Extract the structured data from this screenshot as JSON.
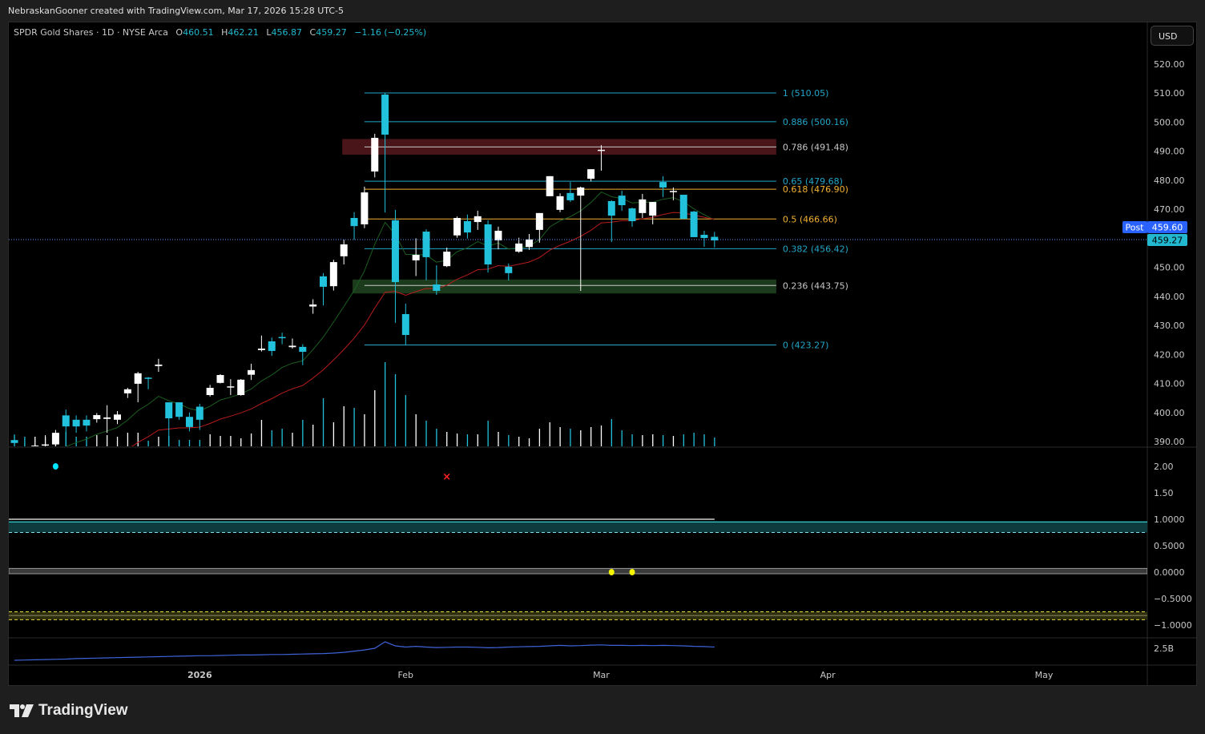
{
  "credit": "NebraskanGooner created with TradingView.com, Mar 17, 2026 15:28 UTC-5",
  "legend": {
    "symbol": "SPDR Gold Shares · 1D · NYSE Arca",
    "o_label": "O",
    "o": "460.51",
    "h_label": "H",
    "h": "462.21",
    "l_label": "L",
    "l": "456.87",
    "c_label": "C",
    "c": "459.27",
    "change": "−1.16 (−0.25%)"
  },
  "currency_button": "USD",
  "price_labels": {
    "post_tag": "Post",
    "post_price": "459.60",
    "last_price": "459.27"
  },
  "logo": "TradingView",
  "colors": {
    "up": "#ffffff",
    "down": "#22c1dc",
    "fib_cyan": "#22a6c8",
    "fib_orange": "#f2b134",
    "fib_grey": "#c8c8c8",
    "ema_fast": "#1b5e20",
    "ema_slow": "#b71c1c",
    "post": "#2962ff"
  },
  "chart_data": {
    "type": "candlestick",
    "title": "SPDR Gold Shares · 1D · NYSE Arca",
    "ylim": [
      390,
      520
    ],
    "y_ticks": [
      "520.00",
      "510.00",
      "500.00",
      "490.00",
      "480.00",
      "470.00",
      "460.00",
      "450.00",
      "440.00",
      "430.00",
      "420.00",
      "410.00",
      "400.00",
      "390.00"
    ],
    "x_ticks": [
      {
        "label": "2026",
        "bar": 18,
        "bold": true
      },
      {
        "label": "Feb",
        "bar": 38
      },
      {
        "label": "Mar",
        "bar": 57
      },
      {
        "label": "Apr",
        "bar": 79
      },
      {
        "label": "May",
        "bar": 100
      }
    ],
    "ohlc": [
      [
        390.5,
        392.5,
        388,
        389.5
      ],
      [
        388,
        389.5,
        386,
        387.5
      ],
      [
        387.5,
        389,
        386,
        388.6
      ],
      [
        388.6,
        392.2,
        388,
        389
      ],
      [
        389,
        394,
        388.5,
        393
      ],
      [
        399,
        401,
        388,
        395.2
      ],
      [
        397.5,
        399,
        393,
        395.2
      ],
      [
        397.5,
        399,
        393.5,
        395.5
      ],
      [
        397.7,
        399.8,
        396.5,
        399.1
      ],
      [
        397.8,
        402.5,
        393,
        398.3
      ],
      [
        397.5,
        400.5,
        396,
        399.3
      ],
      [
        406.6,
        408.5,
        405,
        408
      ],
      [
        409.9,
        414,
        403.5,
        413.5
      ],
      [
        412,
        412.2,
        408,
        411.6
      ],
      [
        416,
        418.5,
        414,
        416.5
      ],
      [
        403.5,
        403.5,
        388,
        398
      ],
      [
        403.5,
        403.5,
        397.5,
        398.5
      ],
      [
        398.5,
        400,
        393.5,
        395
      ],
      [
        402,
        403,
        394,
        397.5
      ],
      [
        406,
        409.5,
        405.5,
        408.5
      ],
      [
        410.2,
        413.2,
        410,
        412.9
      ],
      [
        408.6,
        411.5,
        406,
        409
      ],
      [
        406,
        411.5,
        405.8,
        411.3
      ],
      [
        413,
        416.8,
        411.2,
        414.6
      ],
      [
        421.5,
        426.5,
        421,
        422
      ],
      [
        424.5,
        425.8,
        419.5,
        421.2
      ],
      [
        426,
        427.5,
        423.5,
        425.8
      ],
      [
        422.5,
        425.5,
        422,
        423
      ],
      [
        422.6,
        423.5,
        416.3,
        420.9
      ],
      [
        436.5,
        439,
        434,
        437.2
      ],
      [
        446.9,
        448,
        436.9,
        443.3
      ],
      [
        443.5,
        452.6,
        442,
        451.8
      ],
      [
        453.8,
        459.5,
        451,
        457.9
      ],
      [
        467,
        469,
        459.5,
        464.2
      ],
      [
        464.8,
        477.8,
        463.5,
        475.8
      ],
      [
        483,
        496,
        481,
        494.6
      ],
      [
        509.5,
        510.05,
        468.9,
        495.7
      ],
      [
        466.2,
        469.8,
        430.9,
        444.9
      ],
      [
        433.9,
        437.5,
        423.27,
        426.7
      ],
      [
        452.4,
        460,
        447,
        454.3
      ],
      [
        462.3,
        463.1,
        445.5,
        453.5
      ],
      [
        444.1,
        450.7,
        440.5,
        441.9
      ],
      [
        450.4,
        456.8,
        450.1,
        455.4
      ],
      [
        461,
        467.5,
        460.2,
        467
      ],
      [
        465.9,
        468.2,
        459.9,
        462
      ],
      [
        465.6,
        469.5,
        462.9,
        467.6
      ],
      [
        464.8,
        466.2,
        448.2,
        451
      ],
      [
        459.3,
        464,
        456.2,
        462.6
      ],
      [
        450.2,
        451.3,
        445.5,
        448
      ],
      [
        455.4,
        460.2,
        455,
        458.2
      ],
      [
        457,
        461.5,
        456,
        459.6
      ],
      [
        462.9,
        468.7,
        458.5,
        468.7
      ],
      [
        474.5,
        481.4,
        474.5,
        481.4
      ],
      [
        469.8,
        475.5,
        469,
        474.5
      ],
      [
        475.6,
        479.4,
        472.5,
        473.1
      ],
      [
        474.7,
        477.8,
        441.9,
        477.5
      ],
      [
        480.5,
        483.8,
        479.6,
        483.8
      ],
      [
        490.2,
        492.1,
        483.3,
        490.5
      ],
      [
        472.8,
        473.1,
        458.7,
        467.8
      ],
      [
        474.7,
        476.4,
        469.5,
        471.4
      ],
      [
        470.3,
        470.6,
        464,
        465.9
      ],
      [
        468.7,
        475.3,
        467,
        473.4
      ],
      [
        467.8,
        472.5,
        464.8,
        472.5
      ],
      [
        479.4,
        481.4,
        474.2,
        477.5
      ],
      [
        476,
        477.5,
        473.1,
        476.3
      ],
      [
        475,
        475,
        466.7,
        466.7
      ],
      [
        469.2,
        469.5,
        460.4,
        460.4
      ],
      [
        461.2,
        462.6,
        457.1,
        460.1
      ],
      [
        460.51,
        462.21,
        456.87,
        459.27
      ]
    ],
    "volume_millions": [
      14,
      12,
      12,
      12,
      14,
      18,
      12,
      12,
      14,
      14,
      12,
      17,
      17,
      7,
      12,
      13,
      8,
      8,
      8,
      15,
      13,
      13,
      10,
      16,
      33,
      20,
      22,
      17,
      33,
      27,
      60,
      30,
      50,
      48,
      40,
      70,
      105,
      90,
      64,
      40,
      32,
      22,
      18,
      16,
      15,
      15,
      32,
      18,
      14,
      12,
      10,
      22,
      30,
      24,
      22,
      20,
      24,
      26,
      34,
      20,
      15,
      14,
      15,
      14,
      13,
      15,
      17,
      15,
      11
    ],
    "fib": {
      "start_bar": 34,
      "end_bar": 74,
      "levels": [
        {
          "label": "1 (510.05)",
          "price": 510.05,
          "color": "cyan"
        },
        {
          "label": "0.886 (500.16)",
          "price": 500.16,
          "color": "cyan"
        },
        {
          "label": "0.786 (491.48)",
          "price": 491.48,
          "color": "grey"
        },
        {
          "label": "0.65 (479.68)",
          "price": 479.68,
          "color": "cyan"
        },
        {
          "label": "0.618 (476.90)",
          "price": 476.9,
          "color": "orange"
        },
        {
          "label": "0.5 (466.66)",
          "price": 466.66,
          "color": "orange"
        },
        {
          "label": "0.382 (456.42)",
          "price": 456.42,
          "color": "cyan"
        },
        {
          "label": "0.236 (443.75)",
          "price": 443.75,
          "color": "grey"
        },
        {
          "label": "0 (423.27)",
          "price": 423.27,
          "color": "cyan"
        }
      ]
    },
    "zones": [
      {
        "name": "resistance-zone",
        "from_bar": 32,
        "to_bar": 74,
        "low": 488.8,
        "high": 494.2,
        "color": "#4a1518"
      },
      {
        "name": "support-zone",
        "from_bar": 33,
        "to_bar": 74,
        "low": 441.0,
        "high": 445.8,
        "color": "#1c3a1c"
      }
    ],
    "indicator": {
      "y_ticks": [
        "2.00",
        "1.50",
        "1.0000",
        "0.5000",
        "0.0000",
        "−0.5000",
        "−1.0000"
      ],
      "ylim": [
        -1.4,
        2.35
      ],
      "upper_line": 1.0,
      "upper_band": [
        0.75,
        0.95
      ],
      "zero_band": [
        -0.03,
        0.07
      ],
      "lower_band": [
        -0.9,
        -0.75
      ],
      "signals": [
        {
          "type": "cyan-dot",
          "bar": 4,
          "value": 2.0
        },
        {
          "type": "red-x",
          "bar": 42,
          "value": 1.82
        },
        {
          "type": "yellow-dot",
          "bar": 58,
          "value": 0.0
        },
        {
          "type": "yellow-dot",
          "bar": 60,
          "value": 0.0
        }
      ]
    },
    "cumulative_volume": {
      "tick_label": "2.5B",
      "values_billions": [
        2.0,
        2.01,
        2.02,
        2.03,
        2.04,
        2.05,
        2.07,
        2.08,
        2.09,
        2.1,
        2.11,
        2.12,
        2.13,
        2.14,
        2.15,
        2.16,
        2.17,
        2.18,
        2.19,
        2.19,
        2.2,
        2.21,
        2.22,
        2.22,
        2.23,
        2.24,
        2.24,
        2.25,
        2.26,
        2.27,
        2.28,
        2.3,
        2.33,
        2.38,
        2.43,
        2.5,
        2.77,
        2.6,
        2.55,
        2.58,
        2.55,
        2.53,
        2.54,
        2.55,
        2.55,
        2.54,
        2.52,
        2.53,
        2.55,
        2.56,
        2.57,
        2.58,
        2.6,
        2.62,
        2.6,
        2.61,
        2.63,
        2.64,
        2.62,
        2.62,
        2.61,
        2.62,
        2.61,
        2.62,
        2.61,
        2.6,
        2.58,
        2.57,
        2.55
      ]
    }
  }
}
